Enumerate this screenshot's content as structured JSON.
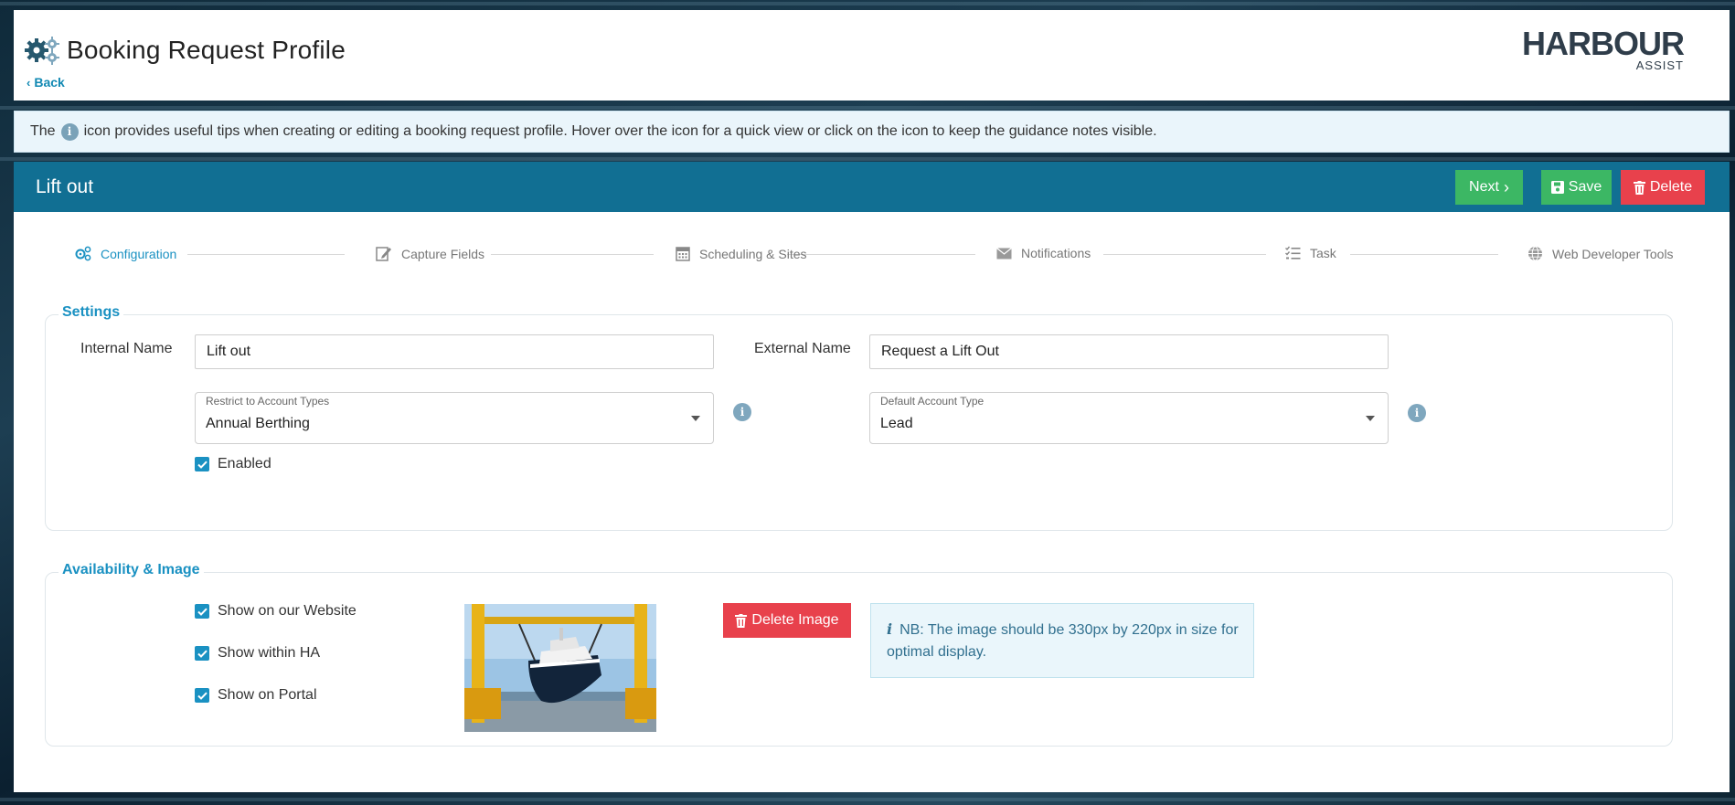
{
  "header": {
    "title": "Booking Request Profile",
    "back_label": "Back",
    "logo_main": "HARBOUR",
    "logo_sub": "ASSIST"
  },
  "banner": {
    "text_before": "The",
    "text_after": "icon provides useful tips when creating or editing a booking request profile. Hover over the icon for a quick view or click on the icon to keep the guidance notes visible."
  },
  "record": {
    "title": "Lift out",
    "next_label": "Next",
    "save_label": "Save",
    "delete_label": "Delete"
  },
  "steps": [
    {
      "label": "Configuration",
      "icon": "gears-icon",
      "active": true
    },
    {
      "label": "Capture Fields",
      "icon": "edit-icon",
      "active": false
    },
    {
      "label": "Scheduling & Sites",
      "icon": "calendar-icon",
      "active": false
    },
    {
      "label": "Notifications",
      "icon": "envelope-icon",
      "active": false
    },
    {
      "label": "Task",
      "icon": "checklist-icon",
      "active": false
    },
    {
      "label": "Web Developer Tools",
      "icon": "globe-icon",
      "active": false
    }
  ],
  "settings": {
    "legend": "Settings",
    "internal_name_label": "Internal Name",
    "internal_name_value": "Lift out",
    "external_name_label": "External Name",
    "external_name_value": "Request a Lift Out",
    "restrict_label": "Restrict to Account Types",
    "restrict_value": "Annual Berthing",
    "default_label": "Default Account Type",
    "default_value": "Lead",
    "enabled_label": "Enabled",
    "enabled": true
  },
  "availability": {
    "legend": "Availability & Image",
    "show_website_label": "Show on our Website",
    "show_ha_label": "Show within HA",
    "show_portal_label": "Show on Portal",
    "delete_image_label": "Delete Image",
    "nb_text": "NB: The image should be 330px by 220px in size for optimal display."
  },
  "colors": {
    "primary": "#116f93",
    "accent": "#1a91c2",
    "success": "#3cb764",
    "danger": "#e8414c"
  }
}
